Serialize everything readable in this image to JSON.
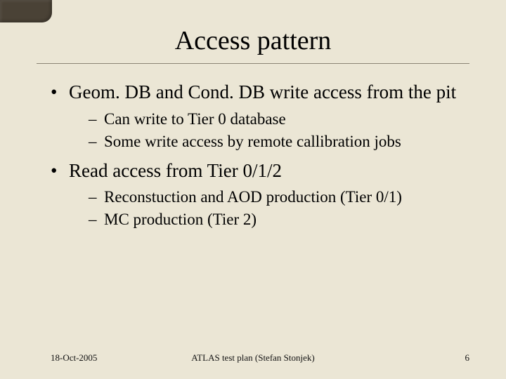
{
  "title": "Access pattern",
  "bullets": {
    "b1": {
      "text": "Geom. DB and Cond. DB write access from the pit",
      "sub": {
        "s1": "Can write to Tier 0 database",
        "s2": "Some write access by remote callibration jobs"
      }
    },
    "b2": {
      "text": "Read access from Tier 0/1/2",
      "sub": {
        "s1": "Reconstuction and AOD production (Tier 0/1)",
        "s2": "MC production (Tier 2)"
      }
    }
  },
  "footer": {
    "date": "18-Oct-2005",
    "center": "ATLAS test plan (Stefan Stonjek)",
    "page": "6"
  }
}
